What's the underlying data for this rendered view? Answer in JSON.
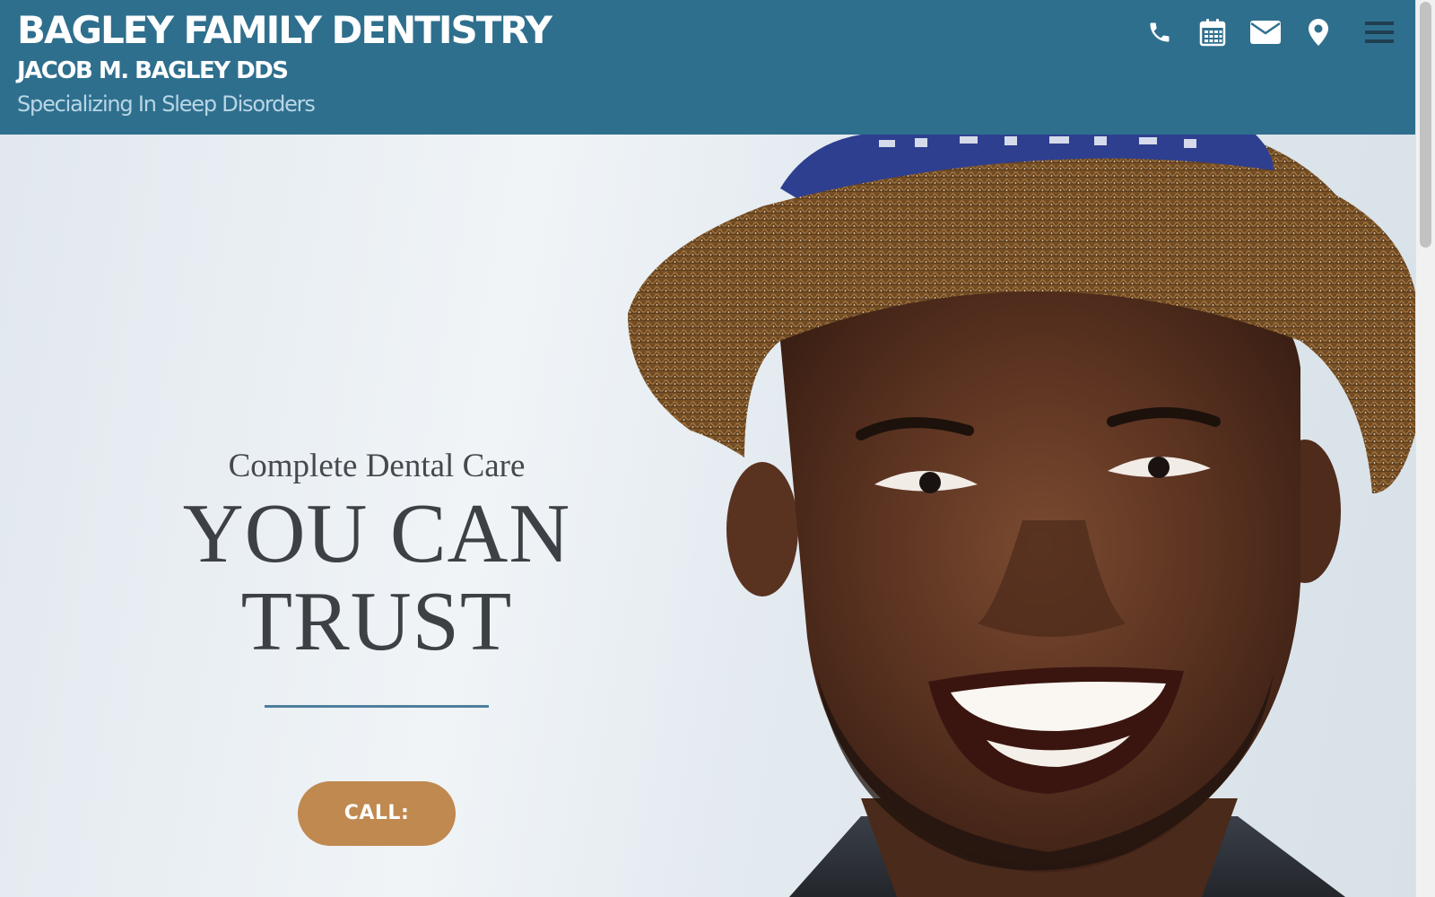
{
  "header": {
    "title": "BAGLEY FAMILY DENTISTRY",
    "doctor": "JACOB M. BAGLEY DDS",
    "tagline": "Specializing In Sleep Disorders",
    "icons": [
      "phone-icon",
      "calendar-icon",
      "envelope-icon",
      "map-marker-icon",
      "menu-icon"
    ],
    "background_color": "#2f6f8e",
    "tagline_color": "#b9d6e6"
  },
  "hero": {
    "eyebrow": "Complete Dental Care",
    "headline_line1": "YOU CAN",
    "headline_line2": "TRUST",
    "call_button_label": "CALL:",
    "button_color": "#c0894f",
    "divider_color": "#4e7f9c",
    "image": "smiling-man-in-straw-hat-photo"
  }
}
